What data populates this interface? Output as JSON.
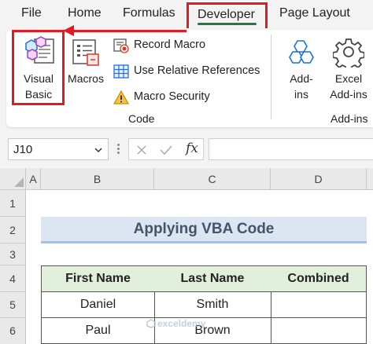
{
  "ribbon_tabs": {
    "file": "File",
    "home": "Home",
    "formulas": "Formulas",
    "developer": "Developer",
    "page_layout": "Page Layout"
  },
  "code_group": {
    "visual_basic_line1": "Visual",
    "visual_basic_line2": "Basic",
    "macros": "Macros",
    "record_macro": "Record Macro",
    "use_relative_references": "Use Relative References",
    "macro_security": "Macro Security",
    "label": "Code"
  },
  "addins_group": {
    "addins_line1": "Add-",
    "addins_line2": "ins",
    "excel_addins_line1": "Excel",
    "excel_addins_line2": "Add-ins",
    "label": "Add-ins"
  },
  "formula_bar": {
    "name_box": "J10",
    "fx": "fx",
    "formula": ""
  },
  "columns": [
    "A",
    "B",
    "C",
    "D"
  ],
  "rows": [
    "1",
    "2",
    "3",
    "4",
    "5",
    "6"
  ],
  "sheet": {
    "title": "Applying VBA Code",
    "headers": [
      "First Name",
      "Last Name",
      "Combined"
    ],
    "data": [
      [
        "Daniel",
        "Smith",
        ""
      ],
      [
        "Paul",
        "Brown",
        ""
      ]
    ]
  },
  "watermark": "exceldemy",
  "colors": {
    "highlight_red": "#e21b23",
    "excel_green": "#1f7a47",
    "title_fill": "#dce6f2",
    "header_fill": "#e2efda"
  }
}
